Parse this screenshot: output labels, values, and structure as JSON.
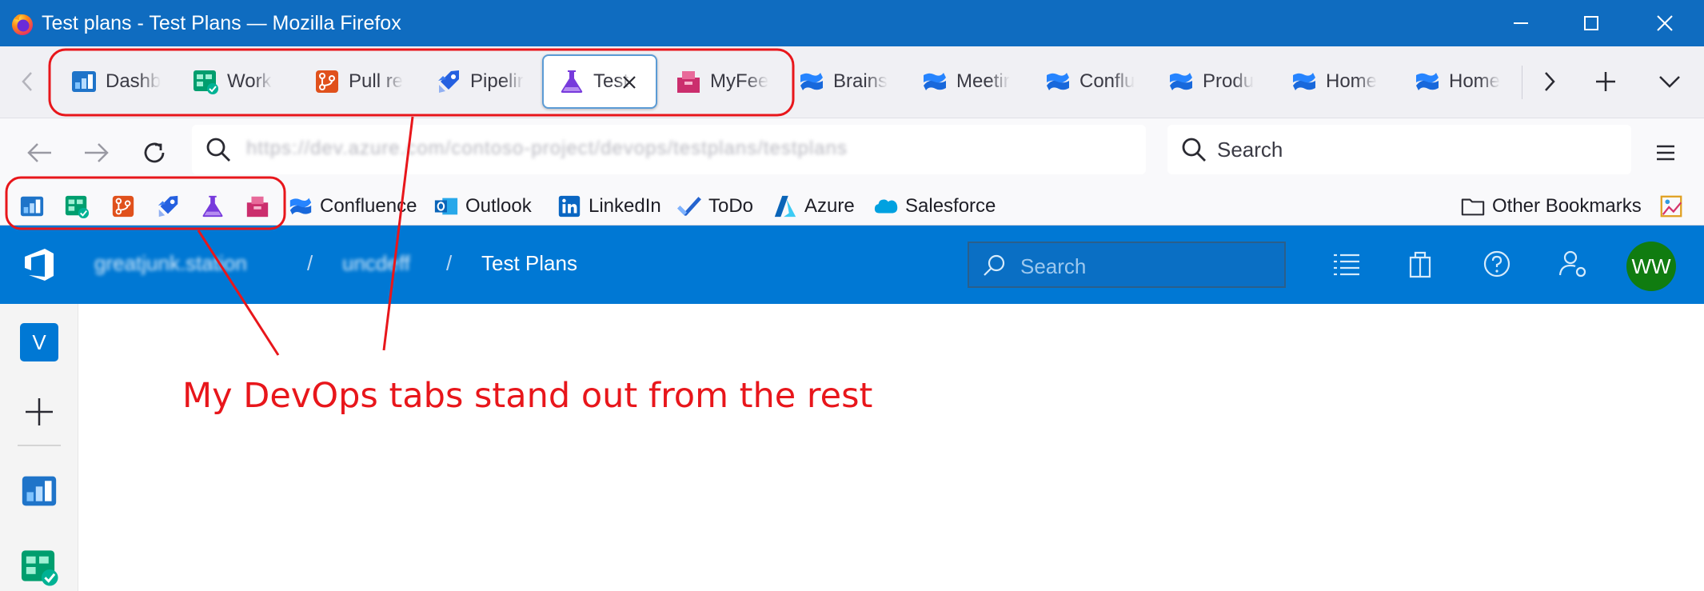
{
  "window": {
    "title": "Test plans - Test Plans — Mozilla Firefox",
    "controls": [
      "minimize-icon",
      "maximize-icon",
      "close-icon"
    ]
  },
  "tabs": [
    {
      "label": "Dashb",
      "icon": "azure-boards-dashboard-icon",
      "active": false,
      "color": "#1f74c9"
    },
    {
      "label": "Work",
      "icon": "azure-boards-icon",
      "active": false,
      "color": "#009e6e"
    },
    {
      "label": "Pull re",
      "icon": "azure-repos-icon",
      "active": false,
      "color": "#e0511c"
    },
    {
      "label": "Pipelir",
      "icon": "azure-pipelines-icon",
      "active": false,
      "color": "#2560e0"
    },
    {
      "label": "Test",
      "icon": "azure-test-plans-icon",
      "active": true,
      "color": "#773adc"
    },
    {
      "label": "MyFee",
      "icon": "azure-artifacts-icon",
      "active": false,
      "color": "#cb2e6d"
    },
    {
      "label": "Brains",
      "icon": "confluence-icon",
      "active": false,
      "color": "#1868db"
    },
    {
      "label": "Meetir",
      "icon": "confluence-icon",
      "active": false,
      "color": "#1868db"
    },
    {
      "label": "Conflu",
      "icon": "confluence-icon",
      "active": false,
      "color": "#1868db"
    },
    {
      "label": "Produ",
      "icon": "confluence-icon",
      "active": false,
      "color": "#1868db"
    },
    {
      "label": "Home",
      "icon": "confluence-icon",
      "active": false,
      "color": "#1868db"
    },
    {
      "label": "Home",
      "icon": "confluence-icon",
      "active": false,
      "color": "#1868db"
    }
  ],
  "nav": {
    "url": "https://dev.azure.com/contoso-project/devops/testplans/testplans",
    "search_placeholder": "Search"
  },
  "bookmarks": {
    "devops_icons": [
      "azure-boards-dashboard-icon",
      "azure-boards-icon",
      "azure-repos-icon",
      "azure-pipelines-icon",
      "azure-test-plans-icon",
      "azure-artifacts-icon"
    ],
    "items": [
      {
        "label": "Confluence",
        "icon": "confluence-icon"
      },
      {
        "label": "Outlook",
        "icon": "outlook-icon"
      },
      {
        "label": "LinkedIn",
        "icon": "linkedin-icon"
      },
      {
        "label": "ToDo",
        "icon": "todo-icon"
      },
      {
        "label": "Azure",
        "icon": "azure-icon"
      },
      {
        "label": "Salesforce",
        "icon": "salesforce-icon"
      }
    ],
    "other": "Other Bookmarks"
  },
  "devops": {
    "breadcrumb": [
      "greatjunk.station",
      "uncdeff",
      "Test Plans"
    ],
    "search_placeholder": "Search",
    "avatar_initials": "WW",
    "org_initial": "V"
  },
  "annotation": {
    "text": "My DevOps tabs stand out from the rest",
    "color": "#e8161b"
  }
}
